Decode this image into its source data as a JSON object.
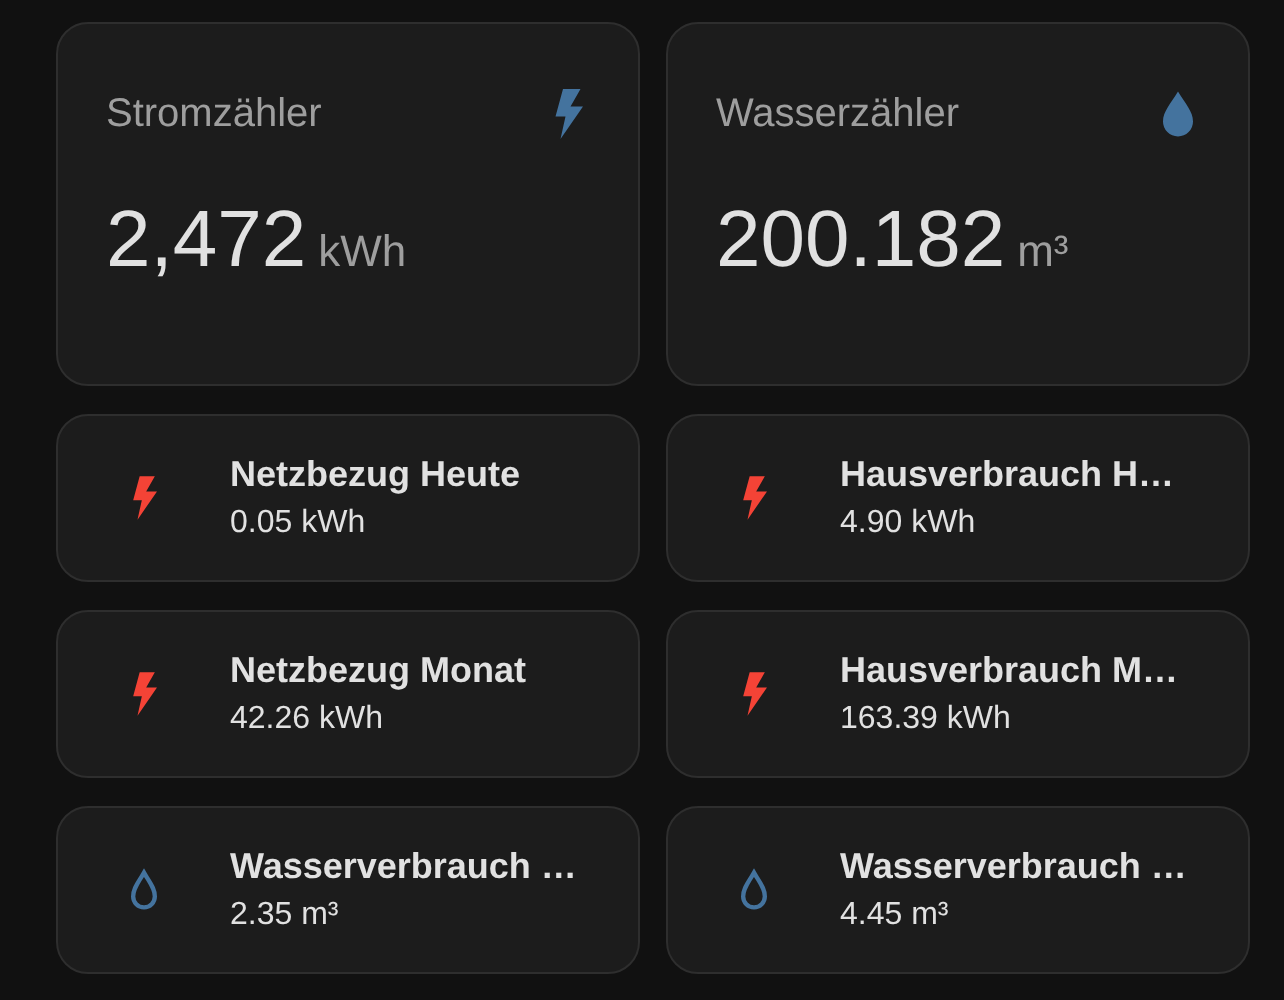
{
  "meters": [
    {
      "title": "Stromzähler",
      "kind": "electric",
      "color": "#44739e",
      "value": "2,472",
      "unit": "kWh"
    },
    {
      "title": "Wasserzähler",
      "kind": "water",
      "color": "#44739e",
      "value": "200.182",
      "unit": "m³"
    }
  ],
  "tiles": [
    {
      "name": "Netzbezug Heute",
      "state": "0.05 kWh",
      "kind": "electric",
      "color": "#f44336"
    },
    {
      "name": "Hausverbrauch H…",
      "state": "4.90 kWh",
      "kind": "electric",
      "color": "#f44336"
    },
    {
      "name": "Netzbezug Monat",
      "state": "42.26 kWh",
      "kind": "electric",
      "color": "#f44336"
    },
    {
      "name": "Hausverbrauch M…",
      "state": "163.39 kWh",
      "kind": "electric",
      "color": "#f44336"
    },
    {
      "name": "Wasserverbrauch …",
      "state": "2.35 m³",
      "kind": "water",
      "color": "#44739e"
    },
    {
      "name": "Wasserverbrauch …",
      "state": "4.45 m³",
      "kind": "water",
      "color": "#44739e"
    }
  ]
}
